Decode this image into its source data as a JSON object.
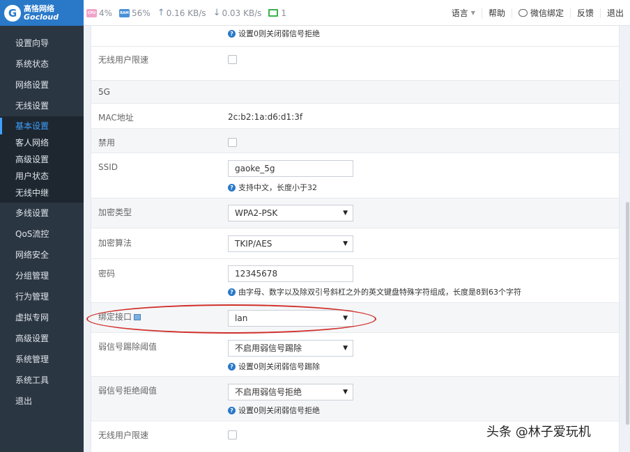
{
  "brand": {
    "name_cn": "高恪网络",
    "name_en": "Gocloud"
  },
  "stats": {
    "cpu_chip": "CPU",
    "cpu": "4%",
    "ram_chip": "RAM",
    "ram": "56%",
    "upload": "0.16 KB/s",
    "upload_arrow": "↑",
    "download": "0.03 KB/s",
    "download_arrow": "↓",
    "devices": "1"
  },
  "topnav": {
    "language": "语言",
    "help": "帮助",
    "wechat": "微信绑定",
    "feedback": "反馈",
    "logout": "退出"
  },
  "sidebar": {
    "items_top": [
      "设置向导",
      "系统状态",
      "网络设置",
      "无线设置"
    ],
    "sub": [
      "基本设置",
      "客人网络",
      "高级设置",
      "用户状态",
      "无线中继"
    ],
    "items_bottom": [
      "多线设置",
      "QoS流控",
      "网络安全",
      "分组管理",
      "行为管理",
      "虚拟专网",
      "高级设置",
      "系统管理",
      "系统工具",
      "退出"
    ]
  },
  "form": {
    "top_hint": "设置0则关闭弱信号拒绝",
    "limit_label_1": "无线用户限速",
    "section_5g": "5G",
    "mac_label": "MAC地址",
    "mac_value": "2c:b2:1a:d6:d1:3f",
    "disable_label": "禁用",
    "ssid_label": "SSID",
    "ssid_value": "gaoke_5g",
    "ssid_hint": "支持中文，长度小于32",
    "enc_type_label": "加密类型",
    "enc_type_value": "WPA2-PSK",
    "enc_algo_label": "加密算法",
    "enc_algo_value": "TKIP/AES",
    "password_label": "密码",
    "password_value": "12345678",
    "password_hint": "由字母、数字以及除双引号斜杠之外的英文键盘特殊字符组成，长度是8到63个字符",
    "bind_label": "绑定接口",
    "bind_value": "lan",
    "kick_label": "弱信号踢除阈值",
    "kick_value": "不启用弱信号踢除",
    "kick_hint": "设置0则关闭弱信号踢除",
    "reject_label": "弱信号拒绝阈值",
    "reject_value": "不启用弱信号拒绝",
    "reject_hint": "设置0则关闭弱信号拒绝",
    "limit_label_2": "无线用户限速"
  },
  "watermark": "头条 @林子爱玩机"
}
